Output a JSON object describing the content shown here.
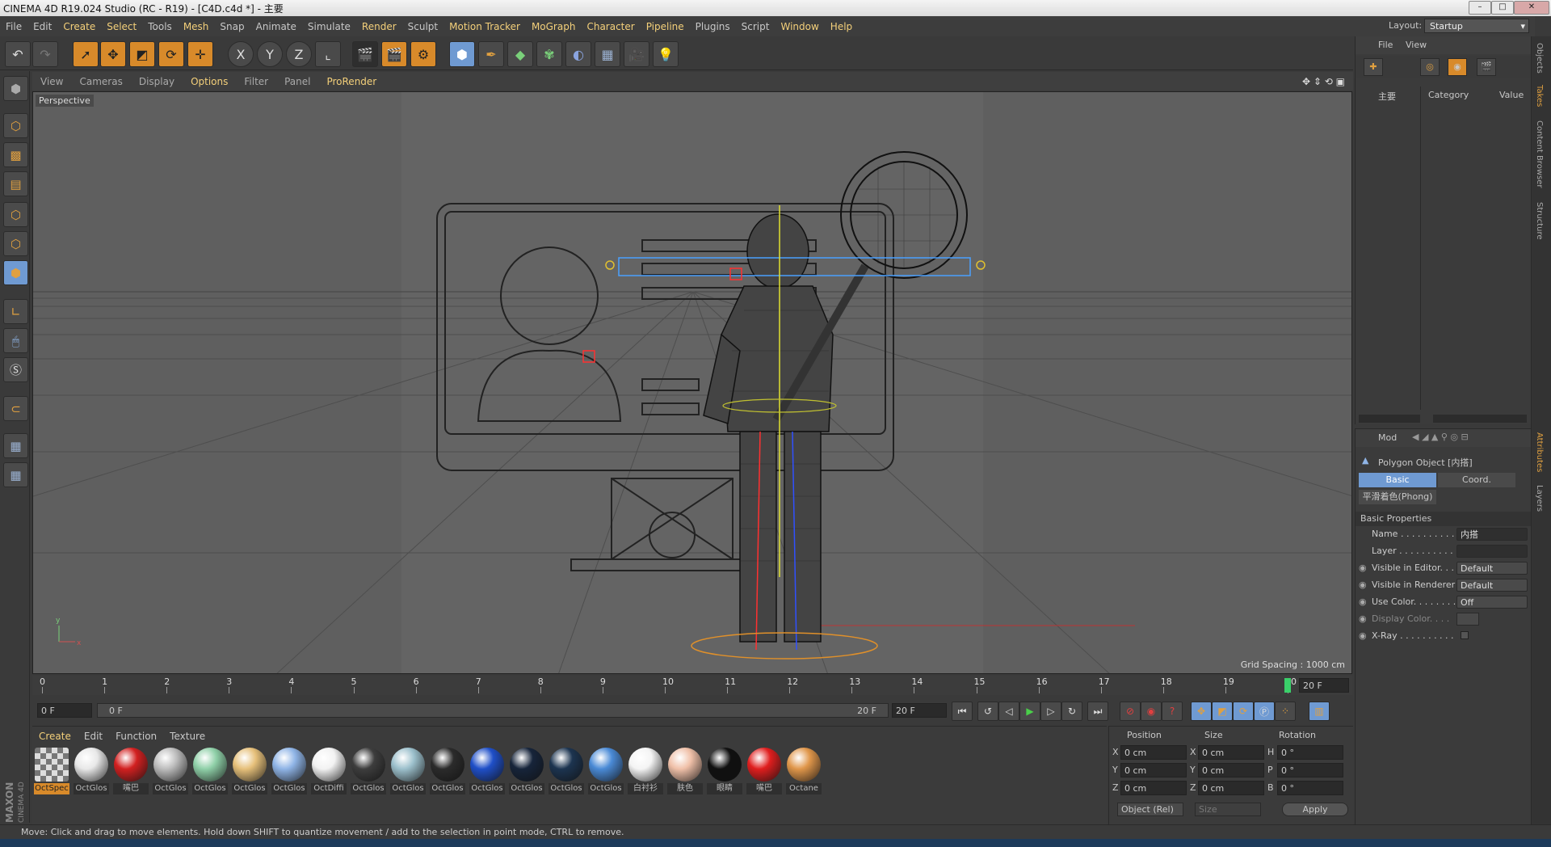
{
  "window": {
    "title": "CINEMA 4D R19.024 Studio (RC - R19) - [C4D.c4d *] - 主要"
  },
  "menubar": [
    "File",
    "Edit",
    "Create",
    "Select",
    "Tools",
    "Mesh",
    "Snap",
    "Animate",
    "Simulate",
    "Render",
    "Sculpt",
    "Motion Tracker",
    "MoGraph",
    "Character",
    "Pipeline",
    "Plugins",
    "Script",
    "Window",
    "Help"
  ],
  "layout": {
    "label": "Layout:",
    "value": "Startup"
  },
  "toolbar": {
    "axis": [
      "X",
      "Y",
      "Z"
    ]
  },
  "viewport": {
    "menu": [
      "View",
      "Cameras",
      "Display",
      "Options",
      "Filter",
      "Panel",
      "ProRender"
    ],
    "camera_label": "Perspective",
    "grid_spacing": "Grid Spacing : 1000 cm"
  },
  "timeline": {
    "ticks": [
      "0",
      "1",
      "2",
      "3",
      "4",
      "5",
      "6",
      "7",
      "8",
      "9",
      "10",
      "11",
      "12",
      "13",
      "14",
      "15",
      "16",
      "17",
      "18",
      "19",
      "20"
    ],
    "current_frame": "20 F",
    "start_field": "0 F",
    "range_start": "0 F",
    "range_end": "20 F",
    "end_field": "20 F"
  },
  "materials": {
    "menu": [
      "Create",
      "Edit",
      "Function",
      "Texture"
    ],
    "items": [
      {
        "label": "OctSpec",
        "color": "#8a8a8a",
        "selected": true
      },
      {
        "label": "OctGlos",
        "color": "#e8e8e8"
      },
      {
        "label": "嘴巴",
        "color": "#d22020"
      },
      {
        "label": "OctGlos",
        "color": "#bdbdbd"
      },
      {
        "label": "OctGlos",
        "color": "#8fd0a8"
      },
      {
        "label": "OctGlos",
        "color": "#e6c07a"
      },
      {
        "label": "OctGlos",
        "color": "#8fb4e6"
      },
      {
        "label": "OctDiffi",
        "color": "#f2f2f2"
      },
      {
        "label": "OctGlos",
        "color": "#3d3d3d"
      },
      {
        "label": "OctGlos",
        "color": "#9cc0cc"
      },
      {
        "label": "OctGlos",
        "color": "#2b2b2b"
      },
      {
        "label": "OctGlos",
        "color": "#1f4fc8"
      },
      {
        "label": "OctGlos",
        "color": "#16243a"
      },
      {
        "label": "OctGlos",
        "color": "#1c3450"
      },
      {
        "label": "OctGlos",
        "color": "#4a8ad6"
      },
      {
        "label": "白衬衫",
        "color": "#f4f4f4"
      },
      {
        "label": "肤色",
        "color": "#f0c0a8"
      },
      {
        "label": "眼睛",
        "color": "#101010"
      },
      {
        "label": "嘴巴",
        "color": "#e01e1e"
      },
      {
        "label": "Octane",
        "color": "#e0964a"
      }
    ]
  },
  "coords": {
    "headers": [
      "Position",
      "Size",
      "Rotation"
    ],
    "rows": [
      {
        "a": "X",
        "pv": "0 cm",
        "b": "X",
        "sv": "0 cm",
        "c": "H",
        "rv": "0 °"
      },
      {
        "a": "Y",
        "pv": "0 cm",
        "b": "Y",
        "sv": "0 cm",
        "c": "P",
        "rv": "0 °"
      },
      {
        "a": "Z",
        "pv": "0 cm",
        "b": "Z",
        "sv": "0 cm",
        "c": "B",
        "rv": "0 °"
      }
    ],
    "mode": "Object (Rel)",
    "size_mode": "Size",
    "apply": "Apply"
  },
  "objects": {
    "menu": [
      "File",
      "View"
    ],
    "col_name": "主要",
    "col_category": "Category",
    "col_value": "Value"
  },
  "attributes": {
    "menu": "Mod",
    "object_title": "Polygon Object [内搭]",
    "tabs": [
      "Basic",
      "Coord."
    ],
    "phong": "平滑着色(Phong)",
    "section": "Basic Properties",
    "rows": [
      {
        "label": "Name . . . . . . . . . . .",
        "value": "内搭"
      },
      {
        "label": "Layer . . . . . . . . . . .",
        "value": ""
      },
      {
        "label": "Visible in Editor. . .",
        "value": "Default"
      },
      {
        "label": "Visible in Renderer",
        "value": "Default"
      },
      {
        "label": "Use Color. . . . . . . .",
        "value": "Off"
      },
      {
        "label": "Display Color. . . .",
        "value": ""
      },
      {
        "label": "X-Ray . . . . . . . . . .",
        "value": ""
      }
    ]
  },
  "side_tabs": [
    "Objects",
    "Takes",
    "Content Browser",
    "Structure",
    "Attributes",
    "Layers"
  ],
  "status": "Move: Click and drag to move elements. Hold down SHIFT to quantize movement / add to the selection in point mode, CTRL to remove.",
  "brand": "MAXON CINEMA 4D"
}
